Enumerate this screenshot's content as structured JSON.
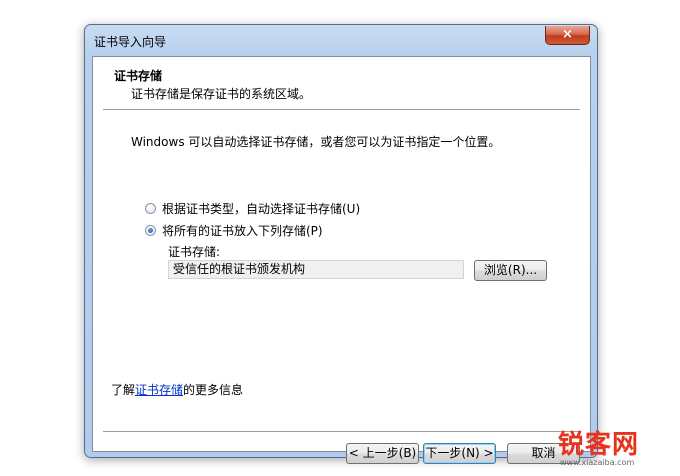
{
  "window": {
    "title": "证书导入向导",
    "close_label": "×"
  },
  "header": {
    "title": "证书存储",
    "subtitle": "证书存储是保存证书的系统区域。"
  },
  "body": {
    "intro": "Windows 可以自动选择证书存储，或者您可以为证书指定一个位置。",
    "options": [
      {
        "label": "根据证书类型，自动选择证书存储(U)",
        "selected": false
      },
      {
        "label": "将所有的证书放入下列存储(P)",
        "selected": true
      }
    ],
    "store_label": "证书存储:",
    "store_value": "受信任的根证书颁发机构",
    "browse_label": "浏览(R)..."
  },
  "more_info": {
    "prefix": "了解",
    "link": "证书存储",
    "suffix": "的更多信息"
  },
  "buttons": {
    "back": "< 上一步(B)",
    "next": "下一步(N) >",
    "cancel": "取消"
  },
  "watermark": {
    "text": "锐客网",
    "url": "www.xiazaiba.com"
  }
}
